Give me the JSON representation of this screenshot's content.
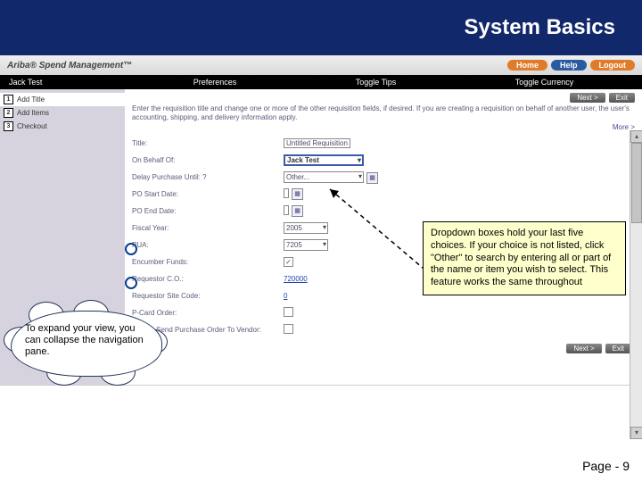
{
  "slide": {
    "title": "System Basics",
    "page_label": "Page - 9"
  },
  "app": {
    "brand": "Ariba® Spend Management™",
    "nav_pills": {
      "home": "Home",
      "help": "Help",
      "logout": "Logout"
    },
    "menubar": {
      "user": "Jack Test",
      "prefs": "Preferences",
      "tips": "Toggle Tips",
      "currency": "Toggle Currency"
    },
    "buttons": {
      "next": "Next >",
      "exit": "Exit"
    },
    "steps": [
      {
        "num": "1",
        "label": "Add Title"
      },
      {
        "num": "2",
        "label": "Add Items"
      },
      {
        "num": "3",
        "label": "Checkout"
      }
    ],
    "instruction": "Enter the requisition title and change one or more of the other requisition fields, if desired. If you are creating a requisition on behalf of another user, the user's accounting, shipping, and delivery information apply.",
    "more": "More >",
    "form": {
      "title_label": "Title:",
      "title_value": "Untitled Requisition",
      "onbehalf_label": "On Behalf Of:",
      "onbehalf_value": "Jack Test",
      "delay_label": "Delay Purchase Until: ?",
      "delay_value": "Other...",
      "postart_label": "PO Start Date:",
      "poend_label": "PO End Date:",
      "fiscal_label": "Fiscal Year:",
      "fiscal_value": "2005",
      "pua_label": "PUA:",
      "pua_value": "7205",
      "encumber_label": "Encumber Funds:",
      "encumber_checked": "✓",
      "reqco_label": "Requestor C.O.:",
      "reqco_value": "720000",
      "site_label": "Requestor Site Code:",
      "site_value": "0",
      "pcard_label": "P-Card Order:",
      "nosend_label": "Do Not Send Purchase Order To Vendor:"
    }
  },
  "callouts": {
    "dropdown_tip": "Dropdown boxes hold your last five choices. If your choice is not listed, click \"Other\" to search by entering all or part of the name or item you wish to select. This feature works the same throughout",
    "collapse_tip": "To expand your view, you can collapse the navigation pane."
  }
}
